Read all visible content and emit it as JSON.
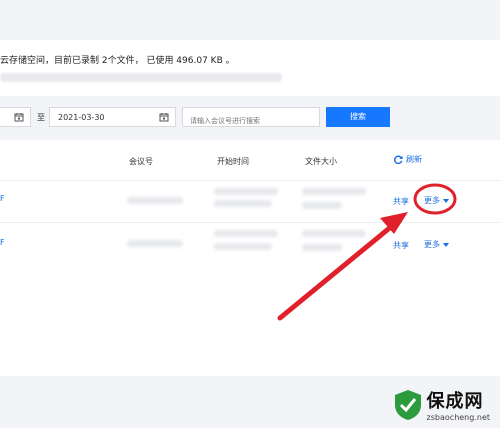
{
  "storage_text": "云存储空间，目前已录制 2个文件， 已使用 496.07 KB 。",
  "filters": {
    "end_date": "2021-03-30",
    "to_label": "至",
    "search_placeholder": "请输入会议号进行搜索",
    "search_button": "搜索"
  },
  "table": {
    "headers": [
      "会议号",
      "开始时间",
      "文件大小"
    ],
    "refresh_label": "刷新",
    "rows": [
      {
        "left_fragment": "F",
        "share": "共享",
        "more": "更多"
      },
      {
        "left_fragment": "F",
        "share": "共享",
        "more": "更多"
      }
    ]
  },
  "colors": {
    "accent": "#1677ff",
    "link": "#1b6fe3",
    "annotation": "#e0202a"
  },
  "watermark": {
    "title": "保成网",
    "subtitle": "zsbaocheng.net"
  }
}
